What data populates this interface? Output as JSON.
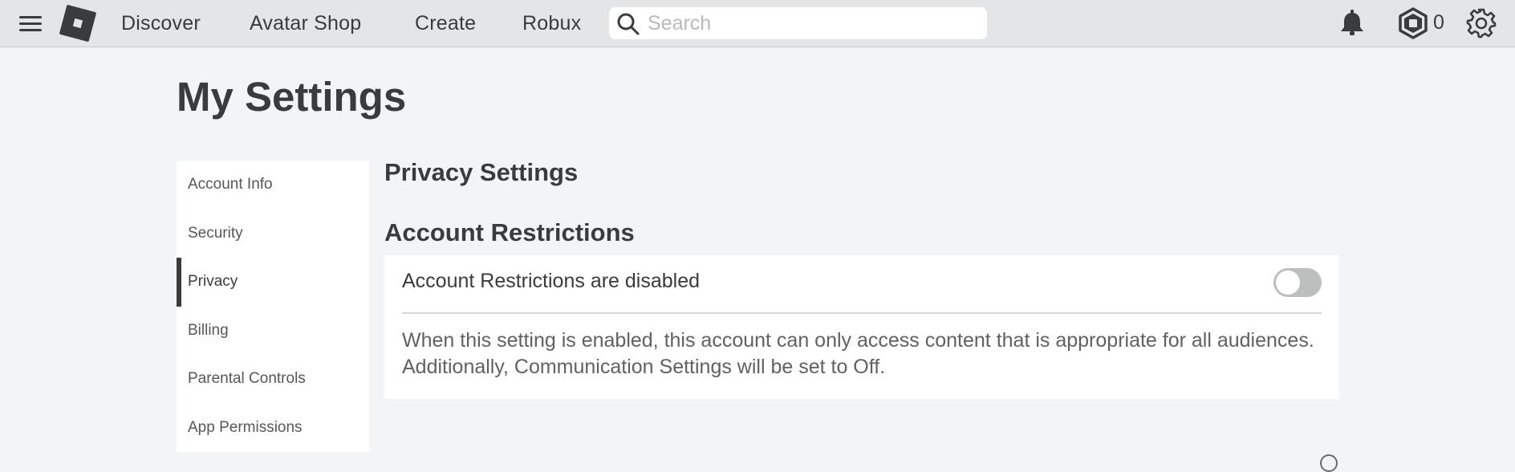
{
  "topbar": {
    "menu_icon": "hamburger-menu-icon",
    "logo_icon": "roblox-logo-icon",
    "nav": [
      {
        "label": "Discover"
      },
      {
        "label": "Avatar Shop"
      },
      {
        "label": "Create"
      },
      {
        "label": "Robux"
      }
    ],
    "search": {
      "placeholder": "Search",
      "value": ""
    },
    "notifications_icon": "bell-icon",
    "robux_icon": "robux-icon",
    "robux_balance": "0",
    "settings_icon": "gear-icon"
  },
  "page": {
    "title": "My Settings"
  },
  "sidebar": {
    "items": [
      {
        "label": "Account Info",
        "active": false
      },
      {
        "label": "Security",
        "active": false
      },
      {
        "label": "Privacy",
        "active": true
      },
      {
        "label": "Billing",
        "active": false
      },
      {
        "label": "Parental Controls",
        "active": false
      },
      {
        "label": "App Permissions",
        "active": false
      }
    ]
  },
  "main": {
    "section_title": "Privacy Settings",
    "subsection_title": "Account Restrictions",
    "restrictions_card": {
      "label": "Account Restrictions are disabled",
      "toggle_on": false,
      "description": "When this setting is enabled, this account can only access content that is appropriate for all audiences. Additionally, Communication Settings will be set to Off."
    }
  }
}
